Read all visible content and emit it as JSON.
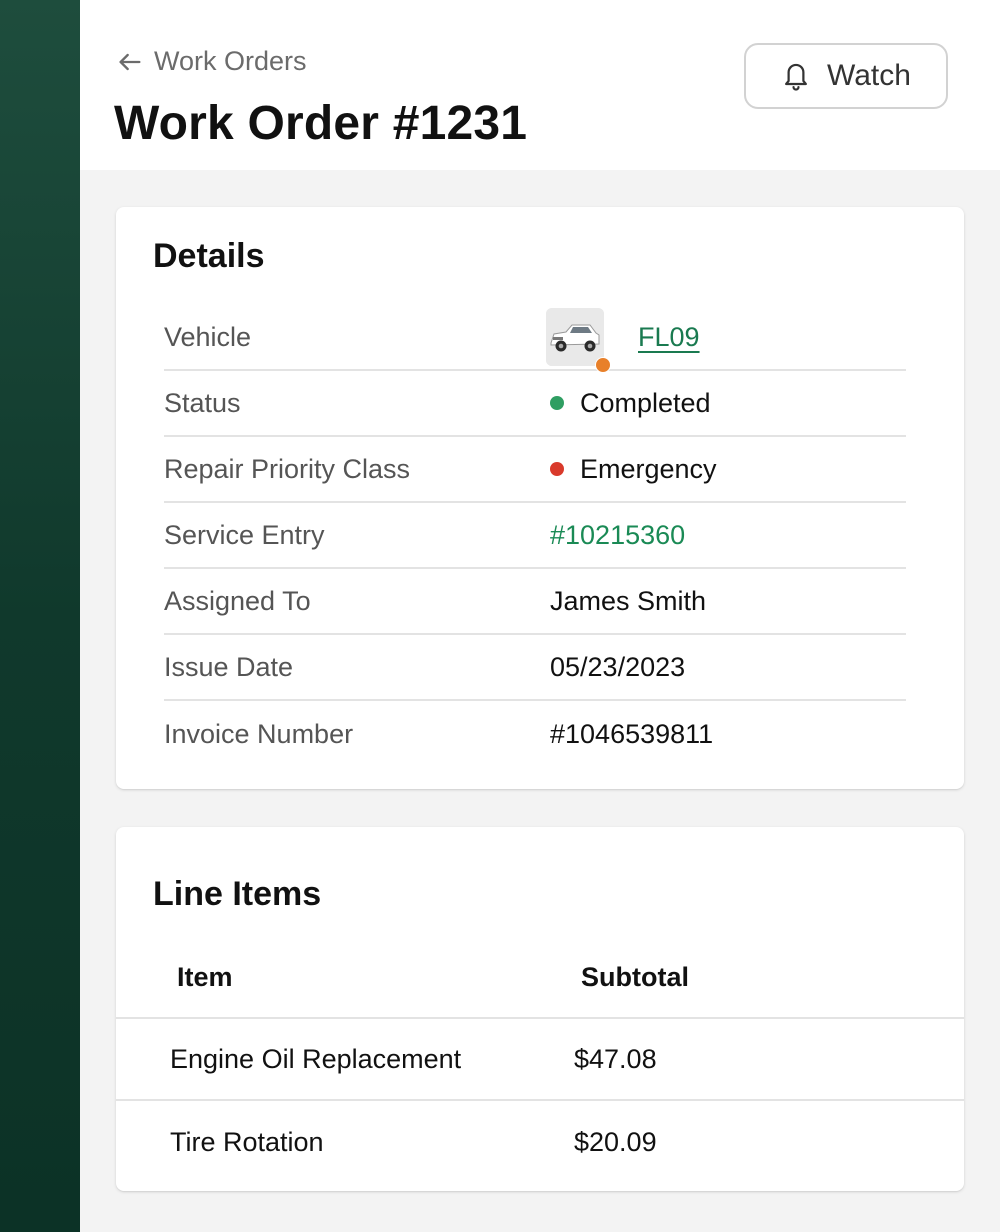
{
  "header": {
    "breadcrumb": "Work Orders",
    "title": "Work Order #1231",
    "watch_label": "Watch"
  },
  "details": {
    "title": "Details",
    "rows": [
      {
        "label": "Vehicle",
        "value": "FL09"
      },
      {
        "label": "Status",
        "value": "Completed"
      },
      {
        "label": "Repair Priority Class",
        "value": "Emergency"
      },
      {
        "label": "Service Entry",
        "value": "#10215360"
      },
      {
        "label": "Assigned To",
        "value": "James Smith"
      },
      {
        "label": "Issue Date",
        "value": "05/23/2023"
      },
      {
        "label": "Invoice Number",
        "value": "#1046539811"
      }
    ]
  },
  "line_items": {
    "title": "Line Items",
    "columns": [
      "Item",
      "Subtotal"
    ],
    "rows": [
      {
        "item": "Engine Oil Replacement",
        "subtotal": "$47.08"
      },
      {
        "item": "Tire Rotation",
        "subtotal": "$20.09"
      }
    ]
  },
  "colors": {
    "sidebar": "#1e4d3d",
    "status_completed": "#2f9e62",
    "priority_emergency": "#d93a2b",
    "vehicle_status": "#e8802a",
    "link": "#1a8a55"
  },
  "icons": {
    "back": "arrow-left-icon",
    "watch": "bell-icon",
    "vehicle": "truck-icon"
  }
}
